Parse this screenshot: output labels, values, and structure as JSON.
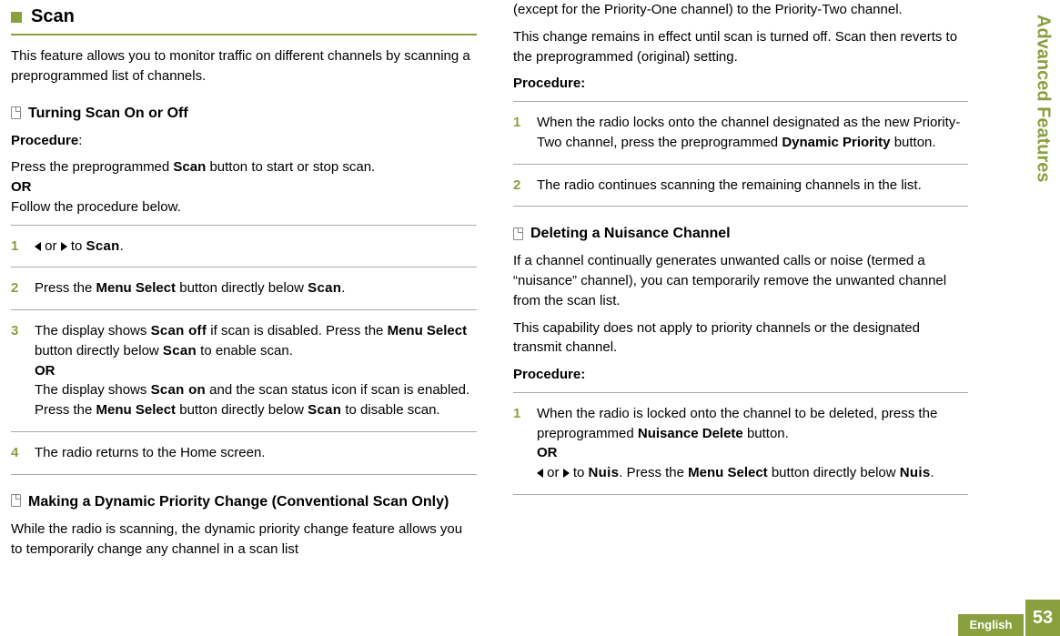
{
  "sidebar": {
    "label": "Advanced Features",
    "pagenum": "53",
    "lang": "English"
  },
  "col1": {
    "heading": "Scan",
    "intro": "This feature allows you to monitor traffic on different channels by scanning a preprogrammed list of channels.",
    "sec1_title": "Turning Scan On or Off",
    "procedure_label": "Procedure",
    "procedure_colon": ":",
    "press_pre": "Press the preprogrammed ",
    "scan_btn": "Scan",
    "press_post": " button to start or stop scan.",
    "or": "OR",
    "follow": "Follow the procedure below.",
    "step1_mid": " or ",
    "step1_to": " to ",
    "step1_scan": "Scan",
    "step1_dot": ".",
    "step2_pre": "Press the ",
    "menu_select": "Menu Select",
    "step2_mid": " button directly below ",
    "step2_scan": "Scan",
    "step2_dot": ".",
    "step3a_pre": "The display shows ",
    "scan_off": "Scan off",
    "step3a_mid": " if scan is disabled. Press the ",
    "step3a_mid2": " button directly below ",
    "step3a_scan": "Scan",
    "step3a_post": " to enable scan.",
    "step3b_pre": "The display shows ",
    "scan_on": "Scan on",
    "step3b_mid": " and the scan status icon if scan is enabled. Press the ",
    "step3b_mid2": " button directly below ",
    "step3b_scan": "Scan",
    "step3b_post": " to disable scan.",
    "step4": "The radio returns to the Home screen.",
    "sec2_title": "Making a Dynamic Priority Change (Conventional Scan Only)",
    "sec2_p": "While the radio is scanning, the dynamic priority change feature allows you to temporarily change any channel in a scan list"
  },
  "col2": {
    "cont": "(except for the Priority-One channel) to the Priority-Two channel.",
    "p2": "This change remains in effect until scan is turned off. Scan then reverts to the preprogrammed (original) setting.",
    "procedure_label": "Procedure:",
    "s1_pre": "When the radio locks onto the channel designated as the new Priority-Two channel, press the preprogrammed ",
    "dynamic_priority": "Dynamic Priority",
    "s1_post": " button.",
    "s2": "The radio continues scanning the remaining channels in the list.",
    "sec3_title": "Deleting a Nuisance Channel",
    "sec3_p1": "If a channel continually generates unwanted calls or noise (termed a “nuisance” channel), you can temporarily remove the unwanted channel from the scan list.",
    "sec3_p2": "This capability does not apply to priority channels or the designated transmit channel.",
    "s1b_pre": "When the radio is locked onto the channel to be deleted, press the preprogrammed ",
    "nuisance_delete": "Nuisance Delete",
    "s1b_post": " button.",
    "or": "OR",
    "s1c_mid": " or ",
    "s1c_to": " to ",
    "nuis": "Nuis",
    "s1c_dot1": ". ",
    "s1c_pre2": "Press the ",
    "menu_select": "Menu Select",
    "s1c_mid2": " button directly below ",
    "s1c_dot2": "."
  },
  "nums": {
    "n1": "1",
    "n2": "2",
    "n3": "3",
    "n4": "4"
  }
}
